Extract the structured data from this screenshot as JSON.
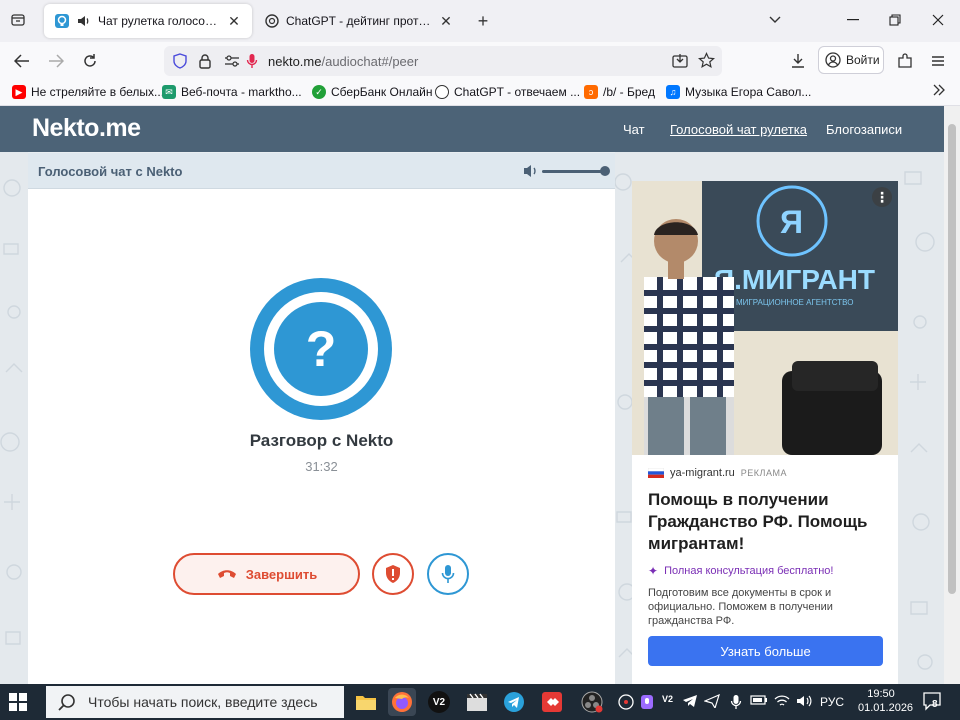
{
  "browser": {
    "tabs": [
      {
        "title": "Чат рулетка голосовая —",
        "active": true,
        "audio": true
      },
      {
        "title": "ChatGPT - дейтинг протокол",
        "active": false
      }
    ],
    "url_host": "nekto.me",
    "url_path": "/audiochat#/peer",
    "signin_label": "Войти",
    "bookmarks": [
      {
        "label": "Не стреляйте в белых...",
        "icon": "youtube-icon",
        "color": "#ff0000"
      },
      {
        "label": "Веб-почта - marktho...",
        "icon": "mail-icon",
        "color": "#1d9a6c"
      },
      {
        "label": "СберБанк Онлайн",
        "icon": "sber-icon",
        "color": "#21a038"
      },
      {
        "label": "ChatGPT - отвечаем ...",
        "icon": "chatgpt-icon",
        "color": "#333333"
      },
      {
        "label": "/b/ - Бред",
        "icon": "2ch-icon",
        "color": "#ff6a00"
      },
      {
        "label": "Музыка Егора Савол...",
        "icon": "vk-icon",
        "color": "#0077ff"
      }
    ]
  },
  "site": {
    "logo": "Nekto.me",
    "menu": [
      "Чат",
      "Голосовой чат рулетка",
      "Блогозаписи"
    ],
    "current_menu_index": 1
  },
  "voice_chat": {
    "card_title": "Голосовой чат с Nekto",
    "volume_level": 1.0,
    "avatar_symbol": "?",
    "talk_title": "Разговор с Nekto",
    "timer": "31:32",
    "end_label": "Завершить"
  },
  "ad": {
    "photo_sign_text": "Я.МИГРАНТ",
    "photo_sign_sub": "МИГРАЦИОННОЕ АГЕНТСТВО",
    "domain": "ya-migrant.ru",
    "tag": "РЕКЛАМА",
    "title": "Помощь в получении Гражданство РФ. Помощь мигрантам!",
    "subtitle": "Полная консультация бесплатно!",
    "text": "Подготовим все документы в срок и официально. Поможем в получении гражданства РФ.",
    "cta": "Узнать больше"
  },
  "taskbar": {
    "search_placeholder": "Чтобы начать поиск, введите здесь",
    "lang": "РУС",
    "time": "19:50",
    "date": "01.01.2026",
    "notification_count": "8"
  },
  "colors": {
    "header": "#4c6377",
    "accent_blue": "#2e97d4",
    "accent_red": "#de4c32",
    "ad_cta": "#3a73f0"
  }
}
